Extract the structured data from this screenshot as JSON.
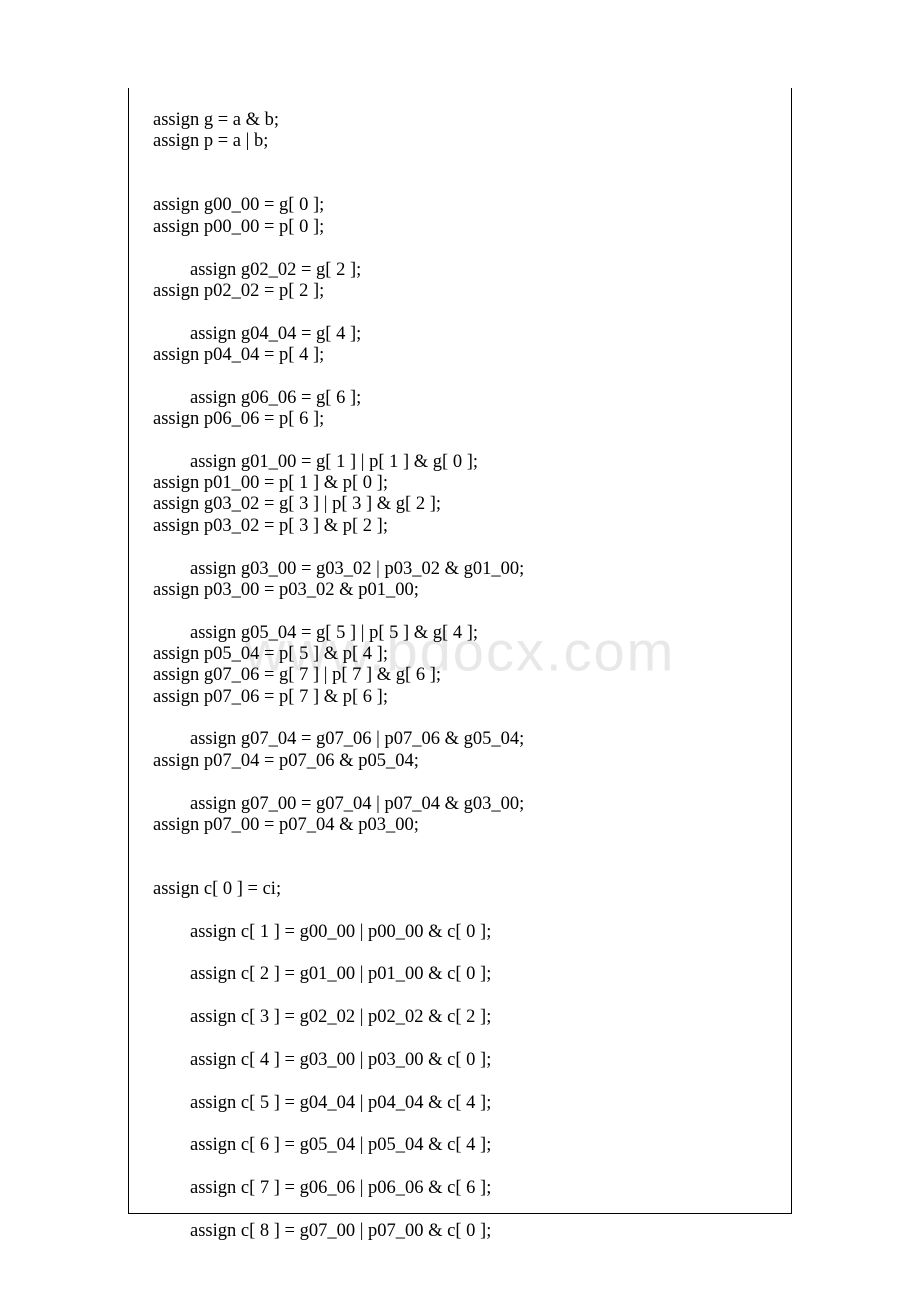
{
  "watermark": "www.bdocx.com",
  "lines": [
    "assign g = a & b;",
    "assign p = a | b;",
    "",
    "",
    "assign g00_00 = g[ 0 ];",
    "assign p00_00 = p[ 0 ];",
    "",
    "        assign g02_02 = g[ 2 ];",
    "assign p02_02 = p[ 2 ];",
    "",
    "        assign g04_04 = g[ 4 ];",
    "assign p04_04 = p[ 4 ];",
    "",
    "        assign g06_06 = g[ 6 ];",
    "assign p06_06 = p[ 6 ];",
    "",
    "        assign g01_00 = g[ 1 ] | p[ 1 ] & g[ 0 ];",
    "assign p01_00 = p[ 1 ] & p[ 0 ];",
    "assign g03_02 = g[ 3 ] | p[ 3 ] & g[ 2 ];",
    "assign p03_02 = p[ 3 ] & p[ 2 ];",
    "",
    "        assign g03_00 = g03_02 | p03_02 & g01_00;",
    "assign p03_00 = p03_02 & p01_00;",
    "",
    "        assign g05_04 = g[ 5 ] | p[ 5 ] & g[ 4 ];",
    "assign p05_04 = p[ 5 ] & p[ 4 ];",
    "assign g07_06 = g[ 7 ] | p[ 7 ] & g[ 6 ];",
    "assign p07_06 = p[ 7 ] & p[ 6 ];",
    "",
    "        assign g07_04 = g07_06 | p07_06 & g05_04;",
    "assign p07_04 = p07_06 & p05_04;",
    "",
    "        assign g07_00 = g07_04 | p07_04 & g03_00;",
    "assign p07_00 = p07_04 & p03_00;",
    "",
    "",
    "assign c[ 0 ] = ci;",
    "",
    "        assign c[ 1 ] = g00_00 | p00_00 & c[ 0 ];",
    "",
    "        assign c[ 2 ] = g01_00 | p01_00 & c[ 0 ];",
    "",
    "        assign c[ 3 ] = g02_02 | p02_02 & c[ 2 ];",
    "",
    "        assign c[ 4 ] = g03_00 | p03_00 & c[ 0 ];",
    "",
    "        assign c[ 5 ] = g04_04 | p04_04 & c[ 4 ];",
    "",
    "        assign c[ 6 ] = g05_04 | p05_04 & c[ 4 ];",
    "",
    "        assign c[ 7 ] = g06_06 | p06_06 & c[ 6 ];",
    "",
    "        assign c[ 8 ] = g07_00 | p07_00 & c[ 0 ];"
  ]
}
